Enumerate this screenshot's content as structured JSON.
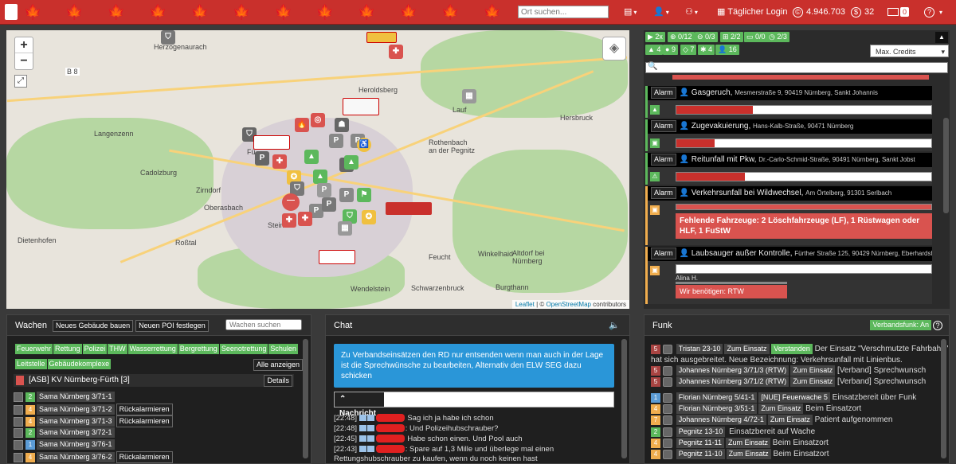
{
  "topbar": {
    "search_placeholder": "Ort suchen...",
    "daily_login": "Täglicher Login",
    "credits": "4.946.703",
    "coins": "32",
    "mail_count": "0",
    "help": "?"
  },
  "map": {
    "labels": [
      "Herzogenaurach",
      "Heroldsberg",
      "Langenzenn",
      "Lauf",
      "Hersbruck",
      "Rothenbach an der Pegnitz",
      "Cadolzburg",
      "Zirndorf",
      "Oberasbach",
      "Stein",
      "Dietenhofen",
      "Roßtal",
      "Wendelstein",
      "Schwarzenbruck",
      "Feucht",
      "Altdorf bei Nürnberg",
      "Winkelhaid",
      "Burgthann",
      "Fü",
      "B 8"
    ],
    "zoom_in": "+",
    "zoom_out": "−",
    "attribution_leaflet": "Leaflet",
    "attribution_sep": " | © ",
    "attribution_osm": "OpenStreetMap",
    "attribution_rest": " contributors"
  },
  "right": {
    "filters": [
      "2x",
      "0/12",
      "0/3",
      "2/2",
      "0/0",
      "2/3"
    ],
    "filters2": [
      "4",
      "9",
      "7",
      "4",
      "16"
    ],
    "max_credits": "Max. Credits",
    "alarm_label": "Alarm",
    "alerts": [
      {
        "title": "Gasgeruch,",
        "addr": "Mesmerstraße 9, 90419 Nürnberg, Sankt Johannis",
        "progress": 0.3
      },
      {
        "title": "Zugevakuierung,",
        "addr": "Hans-Kalb-Straße, 90471 Nürnberg",
        "progress": 0.15
      },
      {
        "title": "Reitunfall mit Pkw,",
        "addr": "Dr.-Carlo-Schmid-Straße, 90491 Nürnberg, Sankt Jobst",
        "progress": 0.27
      },
      {
        "title": "Verkehrsunfall bei Wildwechsel,",
        "addr": "Am Örtelberg, 91301 Serlbach",
        "progress": 0.0,
        "missing": "Fehlende Fahrzeuge: 2 Löschfahrzeuge (LF), 1 Rüstwagen oder HLF, 1 FuStW"
      },
      {
        "title": "Laubsauger außer Kontrolle,",
        "addr": "Fürther Straße 125, 90429 Nürnberg, Eberhardshof",
        "progress": 0.0,
        "player": "Alina H.",
        "need": "Wir benötigen: RTW"
      }
    ]
  },
  "wachen": {
    "title": "Wachen",
    "new_building": "Neues Gebäude bauen",
    "new_poi": "Neuen POI festlegen",
    "search_placeholder": "Wachen suchen",
    "tags": [
      "Feuerwehr",
      "Rettung",
      "Polizei",
      "THW",
      "Wasserrettung",
      "Bergrettung",
      "Seenotrettung",
      "Schulen"
    ],
    "tags2": [
      "Leitstelle",
      "Gebäudekomplexe"
    ],
    "show_all": "Alle anzeigen",
    "building": "[ASB] KV Nürnberg-Fürth [3]",
    "details": "Details",
    "recall": "Rückalarmieren",
    "vehicles": [
      {
        "status": "2",
        "name": "Sama Nürnberg 3/71-1",
        "recall": false
      },
      {
        "status": "4",
        "name": "Sama Nürnberg 3/71-2",
        "recall": true
      },
      {
        "status": "4",
        "name": "Sama Nürnberg 3/71-3",
        "recall": true
      },
      {
        "status": "2",
        "name": "Sama Nürnberg 3/72-1",
        "recall": false
      },
      {
        "status": "1",
        "name": "Sama Nürnberg 3/76-1",
        "recall": false
      },
      {
        "status": "4",
        "name": "Sama Nürnberg 3/76-2",
        "recall": true
      }
    ]
  },
  "chat": {
    "title": "Chat",
    "info": "Zu Verbandseinsätzen den RD nur entsenden wenn man auch in der Lage ist die Sprechwünsche zu bearbeiten, Alternativ den ELW SEG dazu schicken",
    "button": "Nachricht",
    "messages": [
      {
        "time": "[22:48]",
        "text": "Sag ich ja habe ich schon"
      },
      {
        "time": "[22:48]",
        "text": ": Und Polizeihubschrauber?"
      },
      {
        "time": "[22:45]",
        "text": "Habe schon einen. Und Pool auch"
      },
      {
        "time": "[22:43]",
        "text": ": Spare auf 1,3 Mille und überlege mal einen"
      },
      {
        "time": "",
        "text": "Rettungshubschrauber zu kaufen, wenn du noch keinen hast"
      }
    ]
  },
  "funk": {
    "title": "Funk",
    "verbandsfunk": "Verbandsfunk: An",
    "help": "?",
    "zum_einsatz": "Zum Einsatz",
    "verstanden": "Verstanden",
    "entries": [
      {
        "status": "5",
        "name": "Tristan 23-10",
        "msg": "Der Einsatz \"Verschmutzte Fahrbahn\""
      },
      {
        "status": "",
        "name": "",
        "msg": "hat sich ausgebreitet. Neue Bezeichnung: Verkehrsunfall mit Linienbus."
      },
      {
        "status": "5",
        "name": "Johannes Nürnberg 3/71/3 (RTW)",
        "msg": "[Verband] Sprechwunsch"
      },
      {
        "status": "5",
        "name": "Johannes Nürnberg 3/71/2 (RTW)",
        "msg": "[Verband] Sprechwunsch"
      },
      {
        "status": "1",
        "name": "Florian Nürnberg 5/41-1",
        "msg": "Einsatzbereit über Funk",
        "extra": "[NUE] Feuerwache 5"
      },
      {
        "status": "4",
        "name": "Florian Nürnberg 3/51-1",
        "msg": "Beim Einsatzort"
      },
      {
        "status": "7",
        "name": "Johannes Nürnberg 4/72-1",
        "msg": "Patient aufgenommen"
      },
      {
        "status": "2",
        "name": "Pegnitz 13-10",
        "msg": "Einsatzbereit auf Wache"
      },
      {
        "status": "4",
        "name": "Pegnitz 11-11",
        "msg": "Beim Einsatzort"
      },
      {
        "status": "4",
        "name": "Pegnitz 11-10",
        "msg": "Beim Einsatzort"
      }
    ]
  }
}
